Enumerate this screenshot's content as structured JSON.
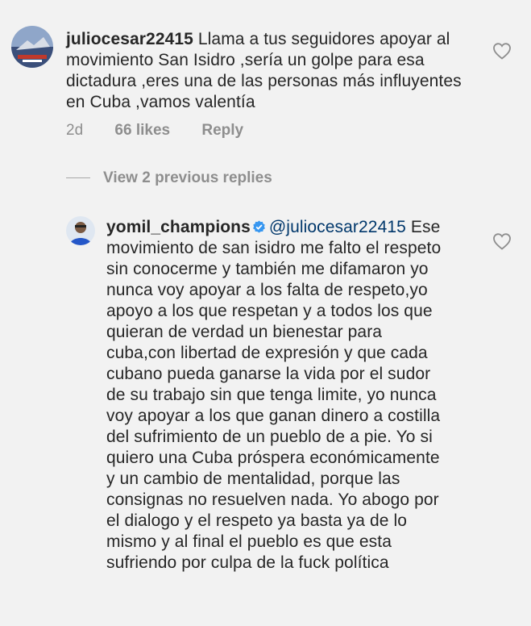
{
  "colors": {
    "background": "#f2f2f2",
    "text": "#262626",
    "muted": "#8e8e8e",
    "mention": "#00376b",
    "verified": "#3897f0"
  },
  "comment1": {
    "username": "juliocesar22415",
    "text": "Llama a tus seguidores apoyar al movimiento San Isidro ,sería un golpe para esa dictadura ,eres una de las personas más influyentes en Cuba ,vamos valentía",
    "time": "2d",
    "likes": "66 likes",
    "reply_label": "Reply",
    "avatar_icon": "profile-photo-icon",
    "like_icon": "heart-outline-icon"
  },
  "replies_toggle": {
    "label": "View 2 previous replies"
  },
  "reply": {
    "username": "yomil_champions",
    "verified_icon": "verified-badge-icon",
    "mention": "@juliocesar22415",
    "text": "Ese movimiento de san isidro me falto el respeto sin conocerme y también me difamaron yo nunca voy apoyar a los falta de respeto,yo apoyo a los que respetan y a todos los que quieran de verdad  un bienestar para cuba,con libertad de expresión y que cada cubano pueda ganarse la vida por el sudor de su trabajo sin que tenga limite, yo nunca voy apoyar a los que ganan dinero a costilla del sufrimiento de un pueblo de a pie. Yo si quiero una Cuba próspera económicamente y un cambio de mentalidad, porque las consignas no resuelven nada. Yo abogo por el dialogo y el respeto ya basta ya de lo mismo y al final el pueblo es que esta sufriendo por culpa de la fuck política",
    "avatar_icon": "profile-photo-icon",
    "like_icon": "heart-outline-icon"
  }
}
